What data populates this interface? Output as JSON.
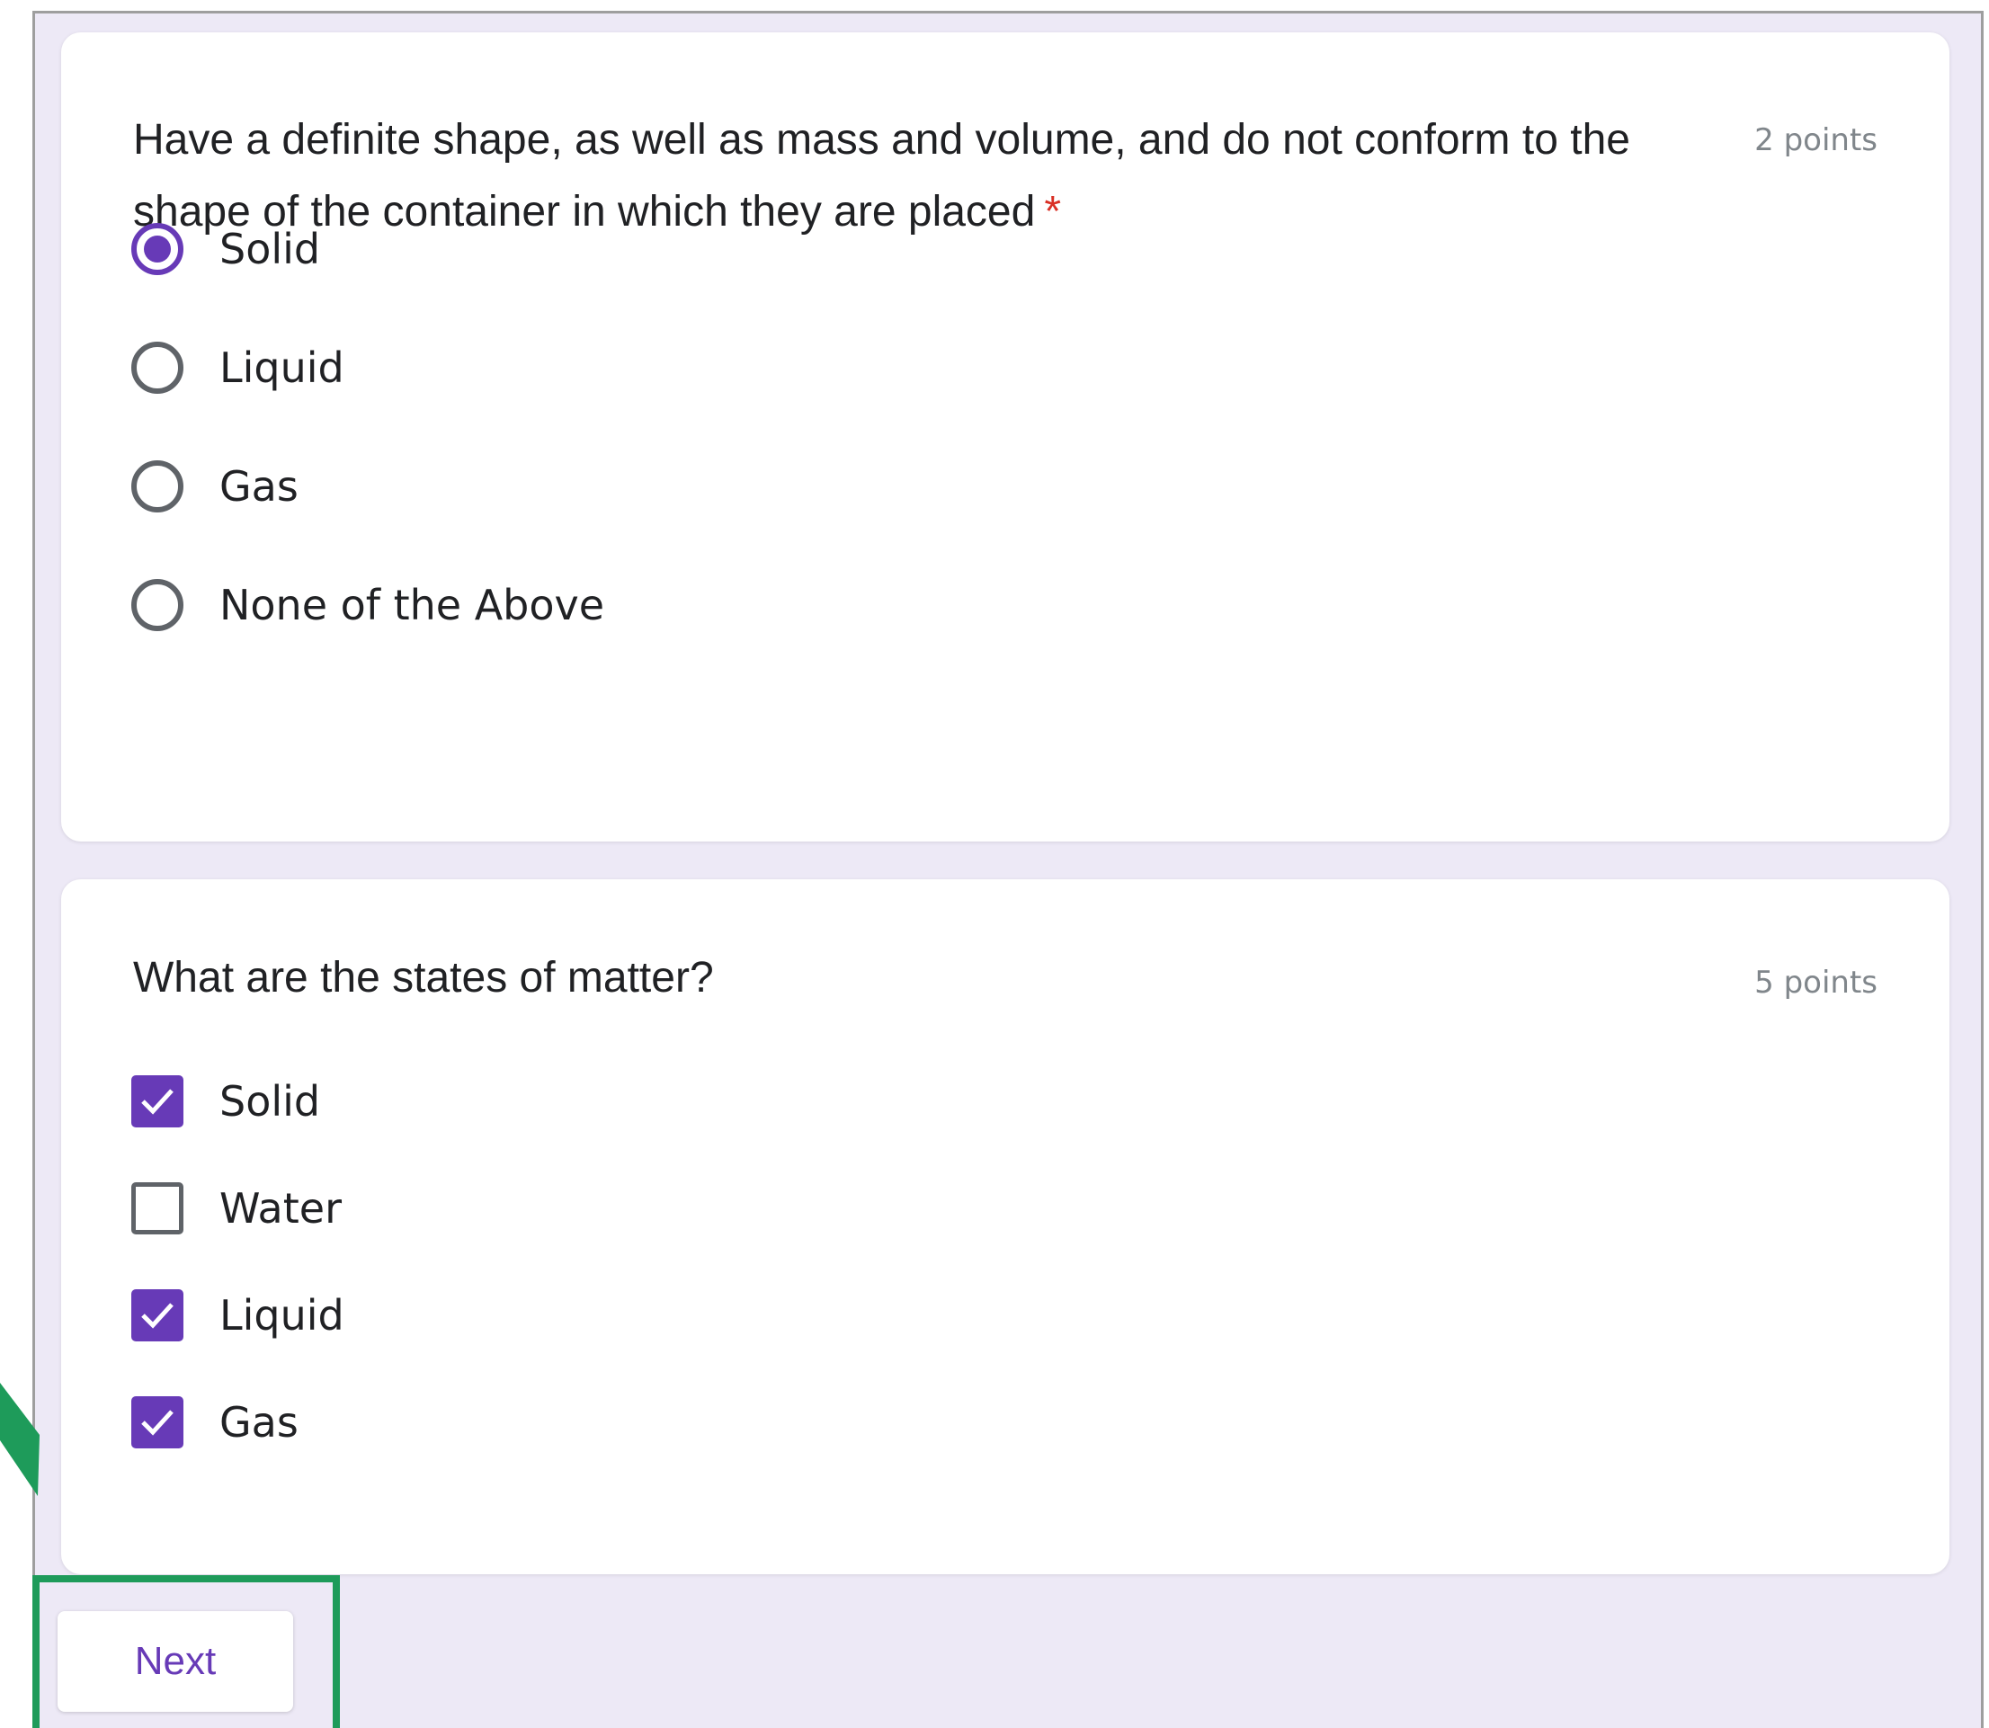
{
  "colors": {
    "accent": "#673ab7",
    "background": "#ede9f6",
    "required": "#d93025",
    "annotation": "#1e9b5a"
  },
  "question1": {
    "title": "Have a definite shape, as well as mass and volume, and do not conform to the shape of the container in which they are placed",
    "required_marker": "*",
    "points": "2 points",
    "type": "radio",
    "options": [
      {
        "label": "Solid",
        "selected": true
      },
      {
        "label": "Liquid",
        "selected": false
      },
      {
        "label": "Gas",
        "selected": false
      },
      {
        "label": "None of the Above",
        "selected": false
      }
    ]
  },
  "question2": {
    "title": "What are the states of matter?",
    "points": "5 points",
    "type": "checkbox",
    "options": [
      {
        "label": "Solid",
        "checked": true
      },
      {
        "label": "Water",
        "checked": false
      },
      {
        "label": "Liquid",
        "checked": true
      },
      {
        "label": "Gas",
        "checked": true
      }
    ]
  },
  "footer": {
    "next_label": "Next"
  },
  "annotation": {
    "icon": "arrow-icon"
  }
}
